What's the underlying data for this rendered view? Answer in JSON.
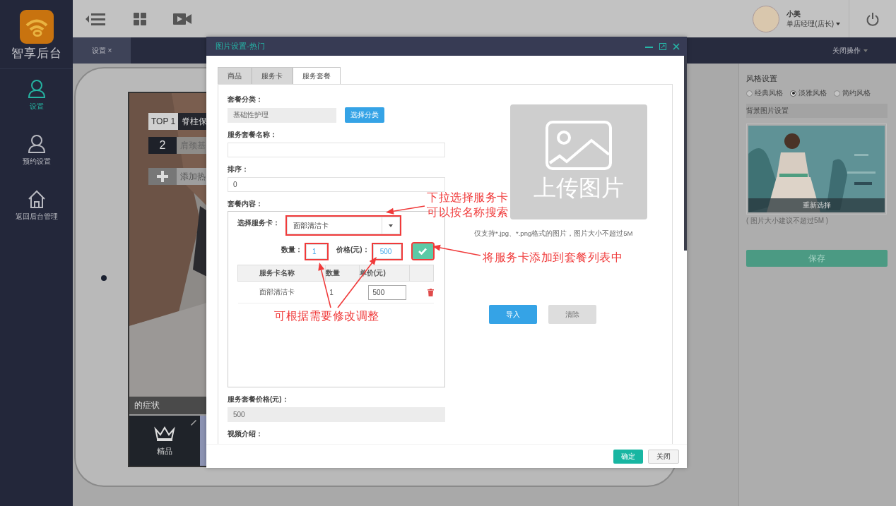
{
  "sidebar": {
    "brand": "智享后台",
    "items": [
      {
        "label": "设置",
        "kind": "user",
        "selected": true
      },
      {
        "label": "预约设置",
        "kind": "user",
        "selected": false
      },
      {
        "label": "返回后台管理",
        "kind": "home",
        "selected": false
      }
    ]
  },
  "header": {
    "user_name": "小美",
    "user_role": "单店经理(店长)"
  },
  "tabs": [
    {
      "label": "设置",
      "close": "×",
      "selected": true
    }
  ],
  "tab_menu": "关闭操作",
  "preview": {
    "rank_items": [
      {
        "badge": "TOP 1",
        "title": "脊柱保",
        "kind": "top"
      },
      {
        "badge": "2",
        "title": "肩颈基",
        "kind": "plain"
      }
    ],
    "add_label": "添加热",
    "caption": "的症状",
    "category": "精品"
  },
  "style_panel": {
    "title": "风格设置",
    "styles": [
      {
        "label": "经典风格",
        "selected": false
      },
      {
        "label": "淡雅风格",
        "selected": true
      },
      {
        "label": "简约风格",
        "selected": false
      }
    ],
    "background_label": "背景图片设置",
    "reselect": "重新选择",
    "hint": "( 图片大小建议不超过5M )",
    "save": "保存"
  },
  "dialog": {
    "title": "图片设置-热门",
    "tabs": [
      {
        "label": "商品",
        "selected": false
      },
      {
        "label": "服务卡",
        "selected": false
      },
      {
        "label": "服务套餐",
        "selected": true
      }
    ],
    "form": {
      "category_label": "套餐分类：",
      "category_value": "基础性护理",
      "choose_category": "选择分类",
      "name_label": "服务套餐名称：",
      "sort_label": "排序：",
      "sort_value": "0",
      "content_label": "套餐内容：",
      "select_label": "选择服务卡：",
      "select": {
        "value": "面部清洁卡",
        "highlighted": true
      },
      "qty_label": "数量：",
      "qty": {
        "value": "1",
        "highlighted": true
      },
      "price_label": "价格(元)：",
      "price": {
        "value": "500",
        "highlighted": true
      },
      "add_button": {
        "highlighted": true
      },
      "columns": [
        "服务卡名称",
        "数量",
        "单价(元)"
      ],
      "rows": [
        {
          "name": "面部清洁卡",
          "qty": "1",
          "price": "500"
        }
      ],
      "package_price_label": "服务套餐价格(元)：",
      "package_price_value": "500",
      "video_label": "视频介绍："
    },
    "upload": {
      "label": "上传图片",
      "hint": "仅支持*.jpg、*.png格式的图片，图片大小不超过5M",
      "import": "导入",
      "clear": "清除"
    },
    "footer_buttons": [
      {
        "label": "确定",
        "kind": "primary"
      },
      {
        "label": "关闭",
        "kind": "default"
      }
    ]
  },
  "annotations": [
    {
      "text": "下拉选择服务卡"
    },
    {
      "text": "可以按名称搜索"
    },
    {
      "text": "将服务卡添加到套餐列表中"
    },
    {
      "text": "可根据需要修改调整"
    }
  ]
}
